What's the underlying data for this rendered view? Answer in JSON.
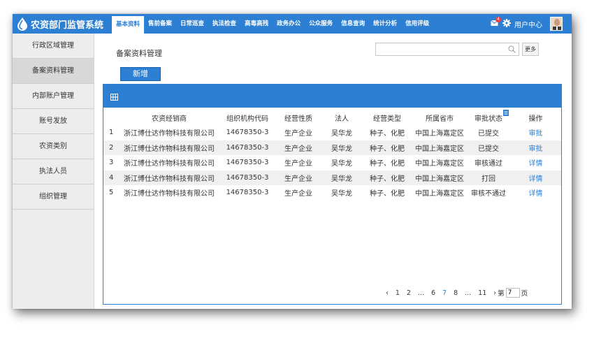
{
  "app": {
    "title": "农资部门监管系统",
    "logo_icon": "water-drop-icon"
  },
  "nav": [
    {
      "label": "基本资料",
      "active": true
    },
    {
      "label": "售前备案"
    },
    {
      "label": "日常巡查"
    },
    {
      "label": "执法检查"
    },
    {
      "label": "高毒高残"
    },
    {
      "label": "政务办公"
    },
    {
      "label": "公众服务"
    },
    {
      "label": "信息查询"
    },
    {
      "label": "统计分析"
    },
    {
      "label": "信用评级"
    }
  ],
  "header": {
    "mail_badge": "4",
    "user_center": "用户中心"
  },
  "sidebar": {
    "items": [
      {
        "label": "行政区域管理"
      },
      {
        "label": "备案资料管理",
        "active": true
      },
      {
        "label": "内部账户管理"
      },
      {
        "label": "账号发放"
      },
      {
        "label": "农资类别"
      },
      {
        "label": "执法人员"
      },
      {
        "label": "组织管理"
      }
    ]
  },
  "main": {
    "page_title": "备案资料管理",
    "search_value": "",
    "more_label": "更多",
    "add_label": "新增"
  },
  "table": {
    "columns": [
      "",
      "农资经销商",
      "组织机构代码",
      "经营性质",
      "法人",
      "经营类型",
      "所属省市",
      "审批状态",
      "操作"
    ],
    "rows": [
      [
        "1",
        "浙江博仕达作物科技有限公司",
        "14678350-3",
        "生产企业",
        "吴华龙",
        "种子、化肥",
        "中国上海嘉定区",
        "已提交",
        "审批"
      ],
      [
        "2",
        "浙江博仕达作物科技有限公司",
        "14678350-3",
        "生产企业",
        "吴华龙",
        "种子、化肥",
        "中国上海嘉定区",
        "已提交",
        "审批"
      ],
      [
        "3",
        "浙江博仕达作物科技有限公司",
        "14678350-3",
        "生产企业",
        "吴华龙",
        "种子、化肥",
        "中国上海嘉定区",
        "审核通过",
        "详情"
      ],
      [
        "4",
        "浙江博仕达作物科技有限公司",
        "14678350-3",
        "生产企业",
        "吴华龙",
        "种子、化肥",
        "中国上海嘉定区",
        "打回",
        "详情"
      ],
      [
        "5",
        "浙江博仕达作物科技有限公司",
        "14678350-3",
        "生产企业",
        "吴华龙",
        "种子、化肥",
        "中国上海嘉定区",
        "审核不通过",
        "详情"
      ]
    ]
  },
  "pager": {
    "prev": "‹",
    "pages": [
      "1",
      "2",
      "...",
      "6",
      "7",
      "8",
      "...",
      "11"
    ],
    "current": "7",
    "next": "›",
    "goto_prefix": "第",
    "goto_value": "7",
    "goto_suffix": "页"
  },
  "colors": {
    "primary": "#2d7fd3",
    "sidebar_bg": "#ededed",
    "row_alt": "#f0f0f0"
  }
}
